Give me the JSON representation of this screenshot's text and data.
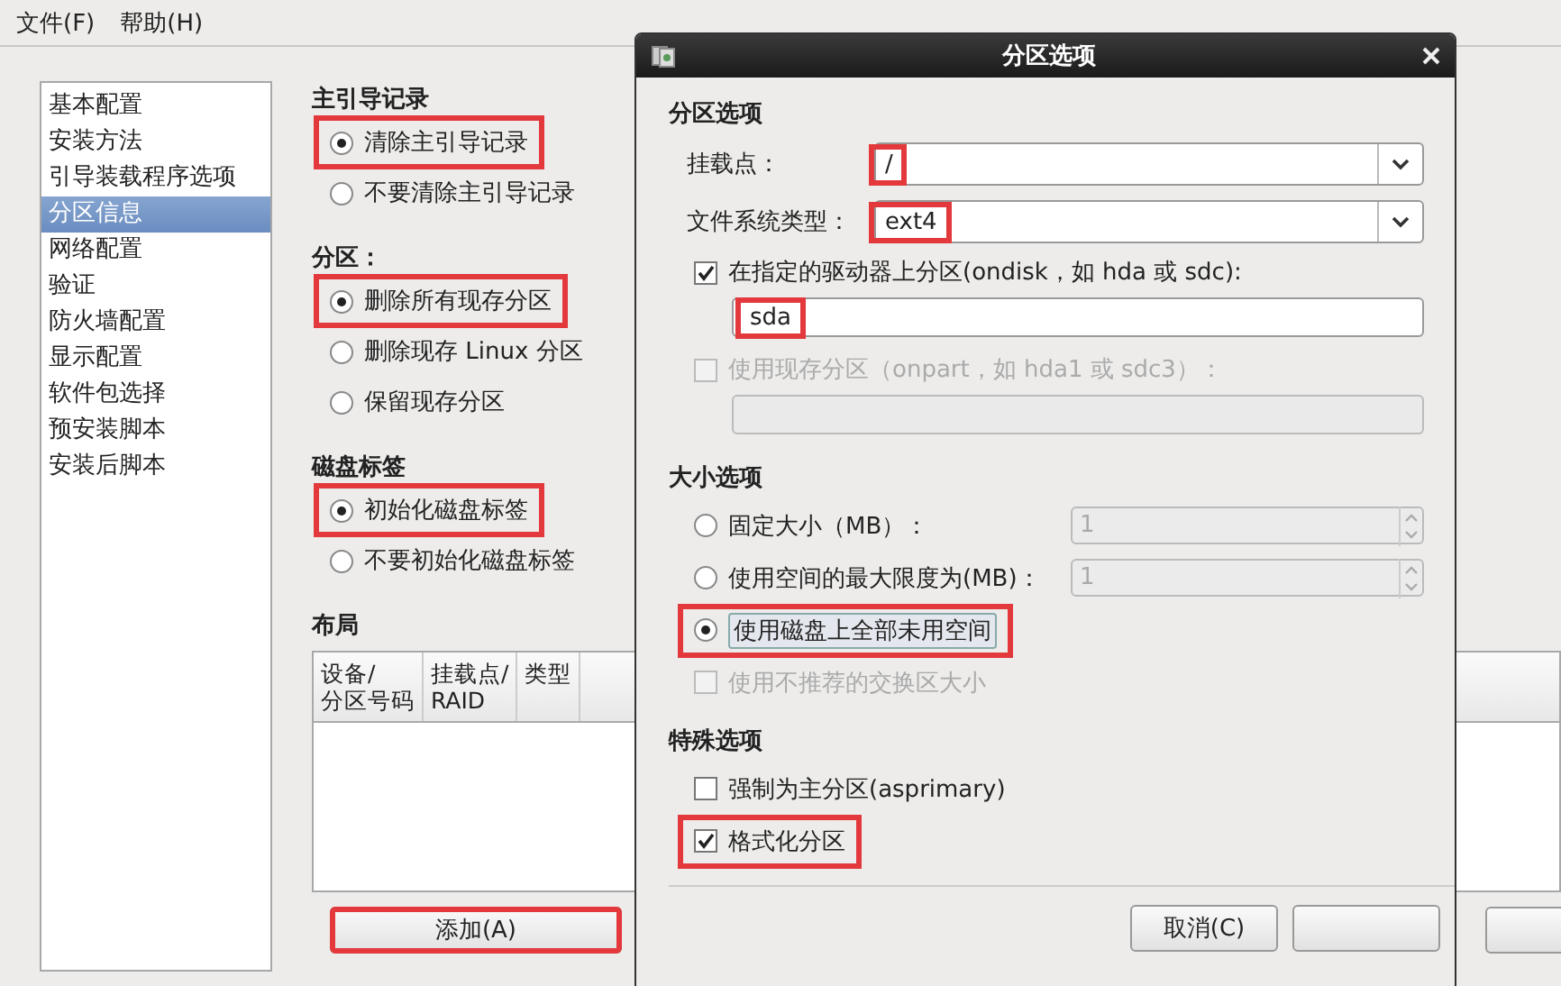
{
  "menu": [
    {
      "label": "文件(F)"
    },
    {
      "label": "帮助(H)"
    }
  ],
  "sidebar": {
    "items": [
      {
        "label": "基本配置",
        "selected": false
      },
      {
        "label": "安装方法",
        "selected": false
      },
      {
        "label": "引导装载程序选项",
        "selected": false
      },
      {
        "label": "分区信息",
        "selected": true
      },
      {
        "label": "网络配置",
        "selected": false
      },
      {
        "label": "验证",
        "selected": false
      },
      {
        "label": "防火墙配置",
        "selected": false
      },
      {
        "label": "显示配置",
        "selected": false
      },
      {
        "label": "软件包选择",
        "selected": false
      },
      {
        "label": "预安装脚本",
        "selected": false
      },
      {
        "label": "安装后脚本",
        "selected": false
      }
    ]
  },
  "sections": [
    {
      "title": "主引导记录",
      "options": [
        {
          "label": "清除主引导记录",
          "selected": true,
          "highlighted": true
        },
        {
          "label": "不要清除主引导记录",
          "selected": false,
          "highlighted": false
        }
      ]
    },
    {
      "title": "分区：",
      "options": [
        {
          "label": "删除所有现存分区",
          "selected": true,
          "highlighted": true
        },
        {
          "label": "删除现存 Linux 分区",
          "selected": false,
          "highlighted": false
        },
        {
          "label": "保留现存分区",
          "selected": false,
          "highlighted": false
        }
      ]
    },
    {
      "title": "磁盘标签",
      "options": [
        {
          "label": "初始化磁盘标签",
          "selected": true,
          "highlighted": true
        },
        {
          "label": "不要初始化磁盘标签",
          "selected": false,
          "highlighted": false
        }
      ]
    }
  ],
  "layout": {
    "title": "布局",
    "columns": [
      {
        "lines": [
          "设备/",
          "分区号码"
        ]
      },
      {
        "lines": [
          "挂载点/",
          "RAID"
        ]
      },
      {
        "lines": [
          "类型"
        ]
      }
    ],
    "add_button": {
      "label": "添加(A)",
      "highlighted": true
    }
  },
  "dialog": {
    "title": "分区选项",
    "partition": {
      "title": "分区选项",
      "fields": [
        {
          "label": "挂载点：",
          "value": "/",
          "highlighted": true
        },
        {
          "label": "文件系统类型：",
          "value": "ext4",
          "highlighted": true
        }
      ],
      "checks": [
        {
          "label": "在指定的驱动器上分区(ondisk，如 hda 或 sdc):",
          "checked": true,
          "disabled": false,
          "value": "sda",
          "highlighted": true
        },
        {
          "label": "使用现存分区（onpart，如 hda1 或 sdc3）：",
          "checked": false,
          "disabled": true
        }
      ]
    },
    "size": {
      "title": "大小选项",
      "options": [
        {
          "kind": "radio-spin",
          "label": "固定大小（MB）：",
          "selected": false,
          "value": "1",
          "disabled": true,
          "highlighted": false
        },
        {
          "kind": "radio-spin",
          "label": "使用空间的最大限度为(MB)：",
          "selected": false,
          "value": "1",
          "disabled": true,
          "highlighted": false
        },
        {
          "kind": "radio",
          "label": "使用磁盘上全部未用空间",
          "selected": true,
          "highlighted": true
        },
        {
          "kind": "checkbox",
          "label": "使用不推荐的交换区大小",
          "checked": false,
          "disabled": true,
          "highlighted": false
        }
      ]
    },
    "special": {
      "title": "特殊选项",
      "options": [
        {
          "label": "强制为主分区(asprimary)",
          "checked": false,
          "highlighted": false
        },
        {
          "label": "格式化分区",
          "checked": true,
          "highlighted": true
        }
      ]
    },
    "buttons": [
      {
        "label": "取消(C)"
      }
    ]
  }
}
